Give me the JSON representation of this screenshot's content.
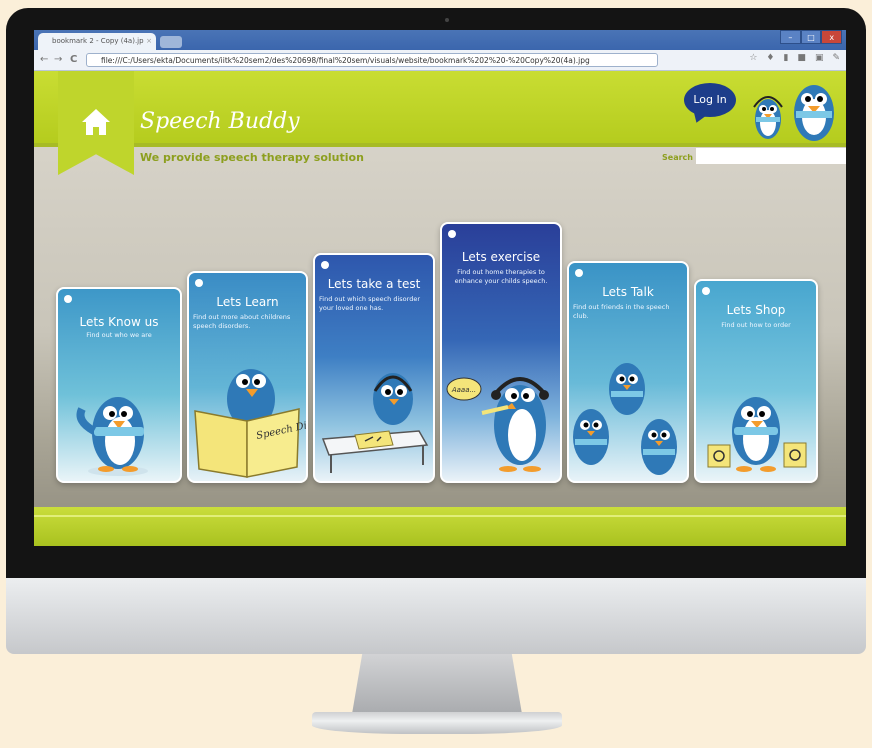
{
  "browser": {
    "tab_title": "bookmark 2 - Copy (4a).jp",
    "tab_close": "×",
    "back": "←",
    "forward": "→",
    "reload": "C",
    "url": "file:///C:/Users/ekta/Documents/iitk%20sem2/des%20698/final%20sem/visuals/website/bookmark%202%20-%20Copy%20(4a).jpg",
    "icons": [
      "star-icon",
      "mic-icon",
      "signal-icon",
      "extension-icon",
      "page-icon",
      "wrench-icon"
    ],
    "window_buttons": [
      "–",
      "□",
      "x"
    ]
  },
  "site": {
    "logo": "Speech Buddy",
    "tagline": "We provide speech therapy solution",
    "login": "Log In",
    "search_label": "Search",
    "search_value": ""
  },
  "cards": [
    {
      "title": "Lets Know us",
      "desc": "Find out who we are"
    },
    {
      "title": "Lets Learn",
      "desc": "Find out more about childrens speech disorders."
    },
    {
      "title": "Lets take a test",
      "desc": "Find out which speech disorder your loved one has."
    },
    {
      "title": "Lets exercise",
      "desc": "Find out home therapies to enhance your childs speech."
    },
    {
      "title": "Lets Talk",
      "desc": "Find out friends in the speech club."
    },
    {
      "title": "Lets Shop",
      "desc": "Find out how to order"
    }
  ],
  "illustrations": {
    "book_text": "Speech Disorder",
    "bubble_text": "Aaaa..."
  },
  "colors": {
    "header_green": "#c4d92e",
    "card_blue": "#3e87c6",
    "card_dark_blue": "#2d4ea3",
    "login_navy": "#1d3d8a"
  }
}
